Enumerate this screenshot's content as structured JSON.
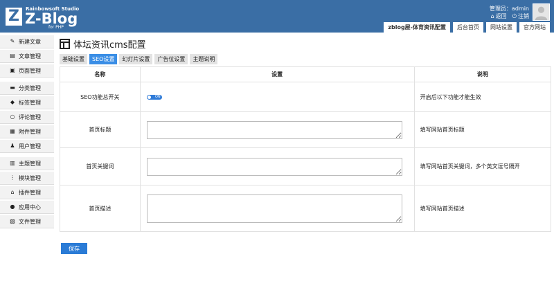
{
  "header": {
    "logo": {
      "mark": "Z",
      "studio": "Rainbowsoft Studio",
      "name": "Z-Blog",
      "tagline": "for PHP"
    },
    "admin_label": "管理员：admin",
    "back_label": "返回",
    "logout_label": "注销",
    "tabs": [
      {
        "label": "zblog屋-体育资讯配置",
        "active": true
      },
      {
        "label": "后台首页"
      },
      {
        "label": "网站设置"
      },
      {
        "label": "官方网站"
      }
    ]
  },
  "sidebar": {
    "items": [
      {
        "label": "新建文章",
        "icon": "edit-icon"
      },
      {
        "label": "文章管理",
        "icon": "article-icon"
      },
      {
        "label": "页面管理",
        "icon": "page-icon"
      },
      {
        "label": "分类管理",
        "icon": "folder-icon"
      },
      {
        "label": "标签管理",
        "icon": "tag-icon"
      },
      {
        "label": "评论管理",
        "icon": "comment-icon"
      },
      {
        "label": "附件管理",
        "icon": "attachment-icon"
      },
      {
        "label": "用户管理",
        "icon": "user-icon"
      },
      {
        "label": "主题管理",
        "icon": "theme-icon"
      },
      {
        "label": "模块管理",
        "icon": "module-icon"
      },
      {
        "label": "插件管理",
        "icon": "plugin-icon"
      },
      {
        "label": "应用中心",
        "icon": "app-center-icon"
      },
      {
        "label": "文件管理",
        "icon": "file-icon"
      }
    ]
  },
  "main": {
    "title": "体坛资讯cms配置",
    "tabs": [
      {
        "label": "基础设置"
      },
      {
        "label": "SEO设置",
        "active": true
      },
      {
        "label": "幻灯片设置"
      },
      {
        "label": "广告位设置"
      },
      {
        "label": "主题说明"
      }
    ],
    "table": {
      "headers": [
        "名称",
        "设置",
        "说明"
      ],
      "rows": [
        {
          "name": "SEO功能总开关",
          "toggle": "ON",
          "desc": "开启后以下功能才能生效"
        },
        {
          "name": "首页标题",
          "value": "",
          "desc": "填写网站首页标题"
        },
        {
          "name": "首页关键词",
          "value": "",
          "desc": "填写网站首页关键词，多个英文逗号隔开"
        },
        {
          "name": "首页描述",
          "value": "",
          "desc": "填写网站首页描述"
        }
      ]
    },
    "save_label": "保存"
  },
  "colors": {
    "header_bg": "#3a6ea5",
    "accent": "#3a8ee6",
    "button": "#2a7bd6"
  }
}
